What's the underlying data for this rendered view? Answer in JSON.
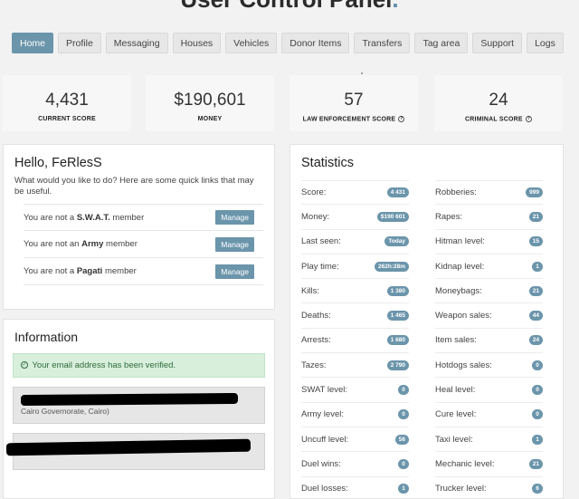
{
  "page": {
    "title": "User Control Panel",
    "title_dot": "."
  },
  "nav": {
    "tabs": [
      {
        "label": "Home",
        "active": true
      },
      {
        "label": "Profile"
      },
      {
        "label": "Messaging"
      },
      {
        "label": "Houses"
      },
      {
        "label": "Vehicles"
      },
      {
        "label": "Donor Items"
      },
      {
        "label": "Transfers"
      },
      {
        "label": "Tag area"
      },
      {
        "label": "Support"
      },
      {
        "label": "Logs"
      }
    ]
  },
  "cards": [
    {
      "value": "4,431",
      "label": "CURRENT SCORE"
    },
    {
      "value": "$190,601",
      "label": "MONEY"
    },
    {
      "value": "57",
      "label": "LAW ENFORCEMENT SCORE",
      "help": "?"
    },
    {
      "value": "24",
      "label": "CRIMINAL SCORE",
      "help": "?"
    }
  ],
  "hello": {
    "title": "Hello, FeRlesS",
    "subtitle": "What would you like to do? Here are some quick links that may be useful.",
    "memberships": [
      {
        "prefix": "You are not a",
        "group": "S.W.A.T.",
        "suffix": "member",
        "button": "Manage"
      },
      {
        "prefix": "You are not an",
        "group": "Army",
        "suffix": "member",
        "button": "Manage"
      },
      {
        "prefix": "You are not a",
        "group": "Pagati",
        "suffix": "member",
        "button": "Manage"
      }
    ]
  },
  "information": {
    "title": "Information",
    "verified_text": "Your email address has been verified.",
    "address_text": "Cairo Governorate, Cairo)"
  },
  "statistics": {
    "title": "Statistics",
    "left": [
      {
        "label": "Score:",
        "value": "4 431"
      },
      {
        "label": "Money:",
        "value": "$190 601"
      },
      {
        "label": "Last seen:",
        "value": "Today"
      },
      {
        "label": "Play time:",
        "value": "262h:28m"
      },
      {
        "label": "Kills:",
        "value": "1 380"
      },
      {
        "label": "Deaths:",
        "value": "1 465"
      },
      {
        "label": "Arrests:",
        "value": "1 680"
      },
      {
        "label": "Tazes:",
        "value": "2 790"
      },
      {
        "label": "SWAT level:",
        "value": "0"
      },
      {
        "label": "Army level:",
        "value": "0"
      },
      {
        "label": "Uncuff level:",
        "value": "56"
      },
      {
        "label": "Duel wins:",
        "value": "0"
      },
      {
        "label": "Duel losses:",
        "value": "1"
      }
    ],
    "right": [
      {
        "label": "Robberies:",
        "value": "999"
      },
      {
        "label": "Rapes:",
        "value": "21"
      },
      {
        "label": "Hitman level:",
        "value": "15"
      },
      {
        "label": "Kidnap level:",
        "value": "1"
      },
      {
        "label": "Moneybags:",
        "value": "21"
      },
      {
        "label": "Weapon sales:",
        "value": "44"
      },
      {
        "label": "Item sales:",
        "value": "24"
      },
      {
        "label": "Hotdogs sales:",
        "value": "0"
      },
      {
        "label": "Heal level:",
        "value": "0"
      },
      {
        "label": "Cure level:",
        "value": "0"
      },
      {
        "label": "Taxi level:",
        "value": "1"
      },
      {
        "label": "Mechanic level:",
        "value": "21"
      },
      {
        "label": "Trucker level:",
        "value": "6"
      }
    ]
  }
}
